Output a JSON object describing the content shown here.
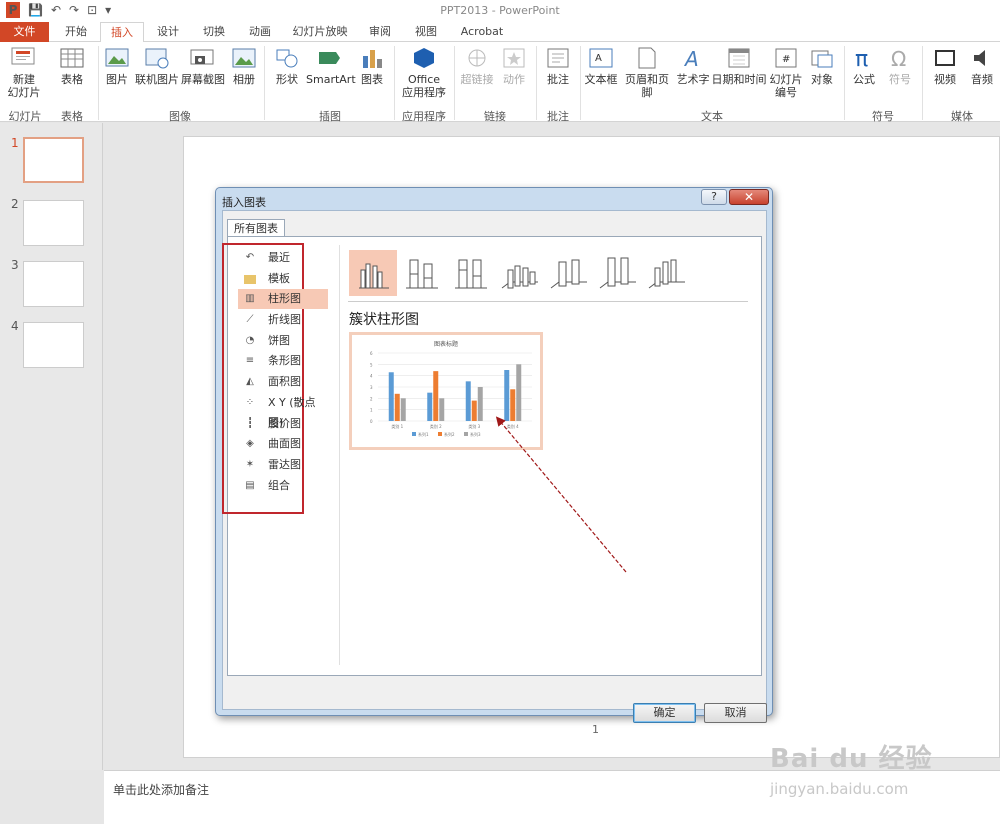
{
  "window": {
    "title": "PPT2013 - PowerPoint"
  },
  "qat": {
    "save": "💾",
    "undo": "↶",
    "redo": "↷",
    "present": "⊡",
    "more": "▾"
  },
  "tabs": [
    "文件",
    "开始",
    "插入",
    "设计",
    "切换",
    "动画",
    "幻灯片放映",
    "审阅",
    "视图",
    "Acrobat"
  ],
  "ribbon": {
    "buttons": [
      "新建\n幻灯片",
      "表格",
      "图片",
      "联机图片",
      "屏幕截图",
      "相册",
      "形状",
      "SmartArt",
      "图表",
      "Office\n应用程序",
      "超链接",
      "动作",
      "批注",
      "文本框",
      "页眉和页脚",
      "艺术字",
      "日期和时间",
      "幻灯片\n编号",
      "对象",
      "公式",
      "符号",
      "视频",
      "音频"
    ],
    "groups": [
      "幻灯片",
      "表格",
      "图像",
      "插图",
      "应用程序",
      "链接",
      "批注",
      "文本",
      "符号",
      "媒体"
    ]
  },
  "slides": {
    "numbers": [
      "1",
      "2",
      "3",
      "4"
    ],
    "page_number": "1"
  },
  "notes": {
    "placeholder": "单击此处添加备注"
  },
  "dialog": {
    "title": "插入图表",
    "help": "?",
    "close": "✕",
    "tab": "所有图表",
    "categories": [
      "最近",
      "模板",
      "柱形图",
      "折线图",
      "饼图",
      "条形图",
      "面积图",
      "X Y (散点图)",
      "股价图",
      "曲面图",
      "雷达图",
      "组合"
    ],
    "selected_category": "柱形图",
    "subtype_title": "簇状柱形图",
    "ok": "确定",
    "cancel": "取消"
  },
  "chart_data": {
    "type": "bar",
    "title": "图表标题",
    "categories": [
      "类别 1",
      "类别 2",
      "类别 3",
      "类别 4"
    ],
    "series": [
      {
        "name": "系列1",
        "values": [
          4.3,
          2.5,
          3.5,
          4.5
        ],
        "color": "#5b9bd5"
      },
      {
        "name": "系列2",
        "values": [
          2.4,
          4.4,
          1.8,
          2.8
        ],
        "color": "#ed7d31"
      },
      {
        "name": "系列3",
        "values": [
          2,
          2,
          3,
          5
        ],
        "color": "#a5a5a5"
      }
    ],
    "ylim": [
      0,
      6
    ],
    "yticks": [
      "0",
      "1",
      "2",
      "3",
      "4",
      "5",
      "6"
    ],
    "legend": "bottom"
  },
  "watermark": {
    "brand": "Bai du 经验",
    "url": "jingyan.baidu.com"
  }
}
